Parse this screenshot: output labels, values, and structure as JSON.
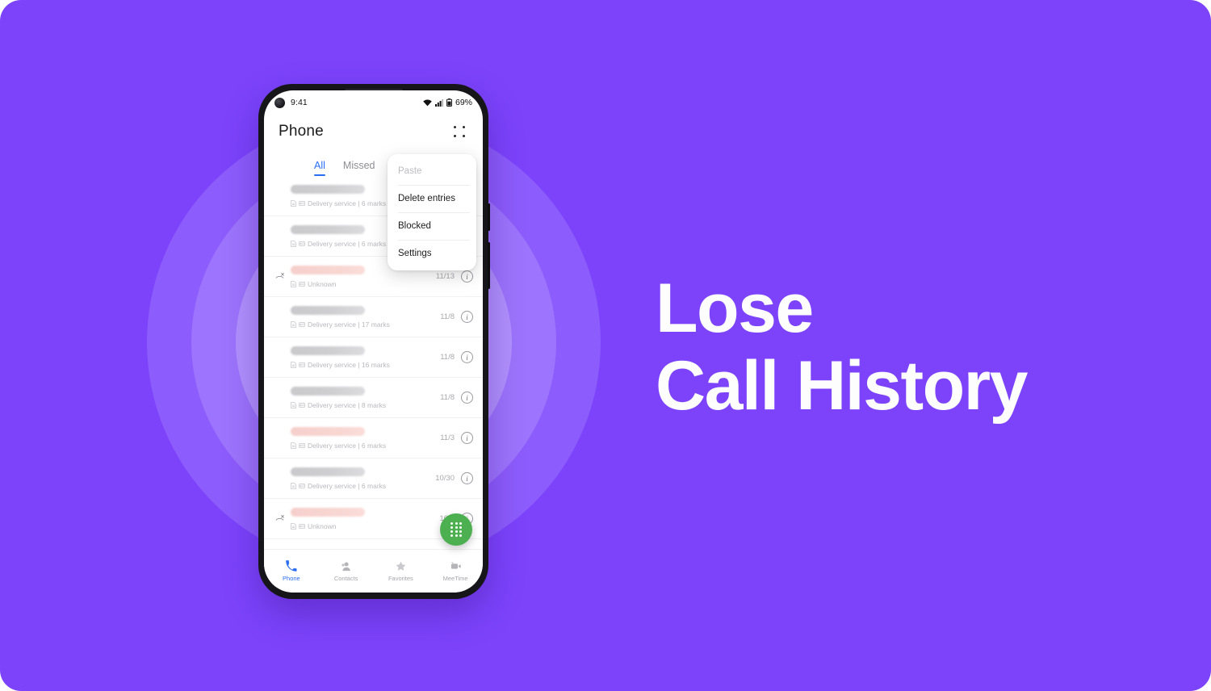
{
  "theme": {
    "background": "#7c43fb",
    "ring_outer": "#8d5cfc",
    "ring_mid": "#9d74fd",
    "ring_inner": "#b191fd",
    "accent_blue": "#2a6df4",
    "fab_green": "#4caf50",
    "headline_color": "#fdfdfd"
  },
  "headline": {
    "line1": "Lose",
    "line2": "Call History"
  },
  "phone": {
    "status_bar": {
      "time": "9:41",
      "battery": "69%",
      "wifi_icon": "wifi-icon",
      "signal_icon": "cellular-signal-icon",
      "battery_icon": "battery-icon",
      "camera_icon": "front-camera-punch-hole"
    },
    "app_bar": {
      "title": "Phone",
      "overflow_icon": "overflow-menu-icon"
    },
    "tabs": [
      {
        "label": "All",
        "active": true
      },
      {
        "label": "Missed",
        "active": false
      }
    ],
    "overflow_menu": [
      {
        "label": "Paste",
        "disabled": true
      },
      {
        "label": "Delete entries",
        "disabled": false
      },
      {
        "label": "Blocked",
        "disabled": false
      },
      {
        "label": "Settings",
        "disabled": false
      }
    ],
    "call_list": [
      {
        "name_redacted": true,
        "redaction_color": "gray",
        "subtitle": "Delivery service | 6 marks",
        "date": "",
        "missed": false,
        "info_label": "i"
      },
      {
        "name_redacted": true,
        "redaction_color": "gray",
        "subtitle": "Delivery service | 6 marks",
        "date": "",
        "missed": false,
        "info_label": "i"
      },
      {
        "name_redacted": true,
        "redaction_color": "pink",
        "subtitle": "Unknown",
        "date": "11/13",
        "missed": true,
        "info_label": "i"
      },
      {
        "name_redacted": true,
        "redaction_color": "gray",
        "subtitle": "Delivery service | 17 marks",
        "date": "11/8",
        "missed": false,
        "info_label": "i"
      },
      {
        "name_redacted": true,
        "redaction_color": "gray",
        "subtitle": "Delivery service | 16 marks",
        "date": "11/8",
        "missed": false,
        "info_label": "i"
      },
      {
        "name_redacted": true,
        "redaction_color": "gray",
        "subtitle": "Delivery service | 8 marks",
        "date": "11/8",
        "missed": false,
        "info_label": "i"
      },
      {
        "name_redacted": true,
        "redaction_color": "pink",
        "subtitle": "Delivery service | 6 marks",
        "date": "11/3",
        "missed": false,
        "info_label": "i"
      },
      {
        "name_redacted": true,
        "redaction_color": "gray",
        "subtitle": "Delivery service | 6 marks",
        "date": "10/30",
        "missed": false,
        "info_label": "i"
      },
      {
        "name_redacted": true,
        "redaction_color": "pink",
        "subtitle": "Unknown",
        "date": "10/2",
        "missed": true,
        "info_label": "i"
      }
    ],
    "fab": {
      "icon": "dialpad-icon"
    },
    "bottom_nav": [
      {
        "label": "Phone",
        "icon": "phone-handset-icon",
        "active": true
      },
      {
        "label": "Contacts",
        "icon": "contacts-person-icon",
        "active": false
      },
      {
        "label": "Favorites",
        "icon": "star-icon",
        "active": false
      },
      {
        "label": "MeeTime",
        "icon": "video-call-icon",
        "active": false
      }
    ]
  }
}
